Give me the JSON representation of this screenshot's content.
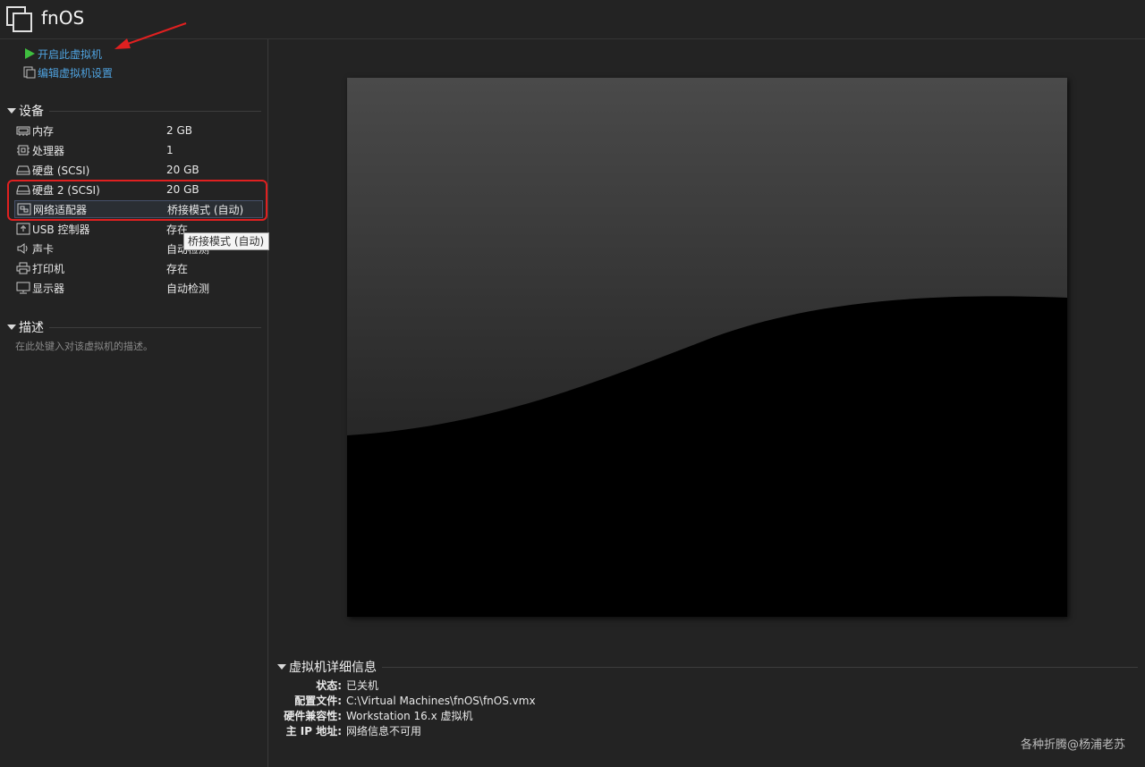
{
  "window": {
    "title": "fnOS"
  },
  "actions": {
    "power_on": "开启此虚拟机",
    "edit_settings": "编辑虚拟机设置"
  },
  "devices": {
    "heading": "设备",
    "items": [
      {
        "icon": "memory-icon",
        "name": "内存",
        "value": "2 GB"
      },
      {
        "icon": "processor-icon",
        "name": "处理器",
        "value": "1"
      },
      {
        "icon": "hard-disk-icon",
        "name": "硬盘 (SCSI)",
        "value": "20 GB"
      },
      {
        "icon": "hard-disk-icon",
        "name": "硬盘 2 (SCSI)",
        "value": "20 GB"
      },
      {
        "icon": "network-adapter-icon",
        "name": "网络适配器",
        "value": "桥接模式 (自动)"
      },
      {
        "icon": "usb-controller-icon",
        "name": "USB 控制器",
        "value": "存在"
      },
      {
        "icon": "sound-card-icon",
        "name": "声卡",
        "value": "自动检测"
      },
      {
        "icon": "printer-icon",
        "name": "打印机",
        "value": "存在"
      },
      {
        "icon": "display-icon",
        "name": "显示器",
        "value": "自动检测"
      }
    ]
  },
  "tooltip": "桥接模式 (自动)",
  "description": {
    "heading": "描述",
    "placeholder": "在此处键入对该虚拟机的描述。"
  },
  "details": {
    "heading": "虚拟机详细信息",
    "rows": [
      {
        "label": "状态:",
        "value": "已关机"
      },
      {
        "label": "配置文件:",
        "value": "C:\\Virtual Machines\\fnOS\\fnOS.vmx"
      },
      {
        "label": "硬件兼容性:",
        "value": "Workstation 16.x 虚拟机"
      },
      {
        "label": "主 IP 地址:",
        "value": "网络信息不可用"
      }
    ]
  },
  "watermark": "各种折腾@杨浦老苏",
  "colors": {
    "link": "#4fa3e0",
    "play": "#3fbf3f",
    "highlight": "#e02020",
    "annotation_arrow": "#e02020"
  }
}
